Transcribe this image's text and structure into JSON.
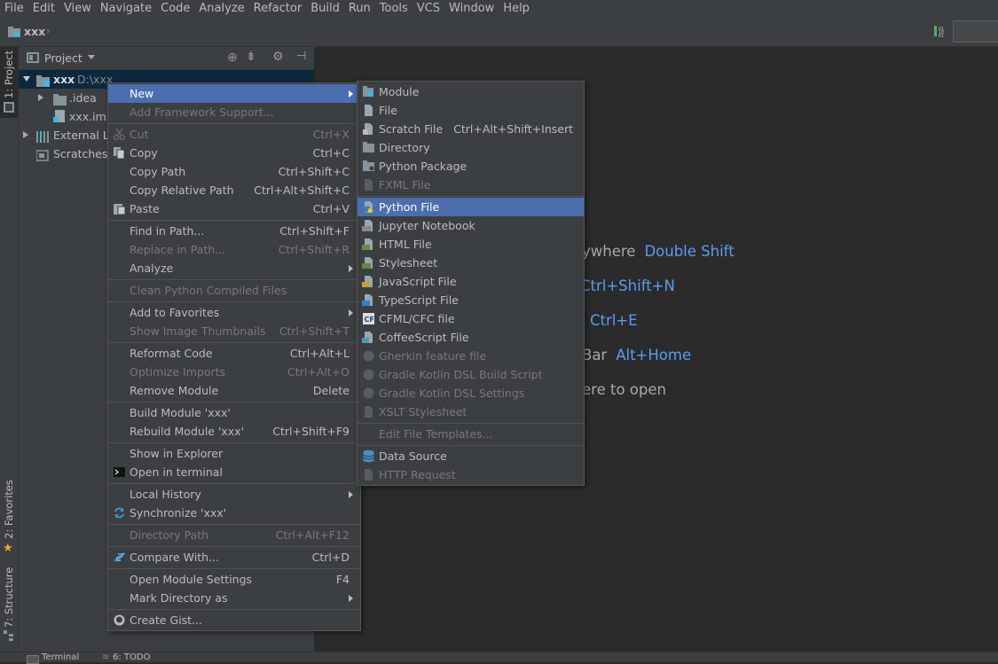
{
  "menubar": [
    "File",
    "Edit",
    "View",
    "Navigate",
    "Code",
    "Analyze",
    "Refactor",
    "Build",
    "Run",
    "Tools",
    "VCS",
    "Window",
    "Help"
  ],
  "breadcrumb": {
    "project": "xxx"
  },
  "side_tabs": {
    "project": "1: Project",
    "favorites": "2: Favorites",
    "structure": "7: Structure"
  },
  "project_panel": {
    "title": "Project"
  },
  "tree": [
    {
      "label": "xxx",
      "path": "D:\\xxx"
    },
    {
      "label": ".idea"
    },
    {
      "label": "xxx.iml"
    },
    {
      "label": "External Li"
    },
    {
      "label": "Scratches a"
    }
  ],
  "context_menu": [
    {
      "label": "New",
      "shortcut": "",
      "submenu": true,
      "highlight": true
    },
    {
      "label": "Add Framework Support...",
      "disabled": true
    },
    {
      "label": "Cut",
      "shortcut": "Ctrl+X",
      "disabled": true,
      "icon": "scissors-icon"
    },
    {
      "label": "Copy",
      "shortcut": "Ctrl+C",
      "icon": "copy-icon"
    },
    {
      "label": "Copy Path",
      "shortcut": "Ctrl+Shift+C"
    },
    {
      "label": "Copy Relative Path",
      "shortcut": "Ctrl+Alt+Shift+C"
    },
    {
      "label": "Paste",
      "shortcut": "Ctrl+V",
      "icon": "paste-icon"
    },
    {
      "label": "Find in Path...",
      "shortcut": "Ctrl+Shift+F"
    },
    {
      "label": "Replace in Path...",
      "shortcut": "Ctrl+Shift+R",
      "disabled": true
    },
    {
      "label": "Analyze",
      "submenu": true
    },
    {
      "label": "Clean Python Compiled Files",
      "disabled": true
    },
    {
      "label": "Add to Favorites",
      "submenu": true
    },
    {
      "label": "Show Image Thumbnails",
      "shortcut": "Ctrl+Shift+T",
      "disabled": true
    },
    {
      "label": "Reformat Code",
      "shortcut": "Ctrl+Alt+L"
    },
    {
      "label": "Optimize Imports",
      "shortcut": "Ctrl+Alt+O",
      "disabled": true
    },
    {
      "label": "Remove Module",
      "shortcut": "Delete"
    },
    {
      "label": "Build Module 'xxx'"
    },
    {
      "label": "Rebuild Module 'xxx'",
      "shortcut": "Ctrl+Shift+F9"
    },
    {
      "label": "Show in Explorer"
    },
    {
      "label": "Open in terminal",
      "icon": "terminal-icon"
    },
    {
      "label": "Local History",
      "submenu": true
    },
    {
      "label": "Synchronize 'xxx'",
      "icon": "sync-icon"
    },
    {
      "label": "Directory Path",
      "shortcut": "Ctrl+Alt+F12",
      "disabled": true
    },
    {
      "label": "Compare With...",
      "shortcut": "Ctrl+D",
      "icon": "compare-icon"
    },
    {
      "label": "Open Module Settings",
      "shortcut": "F4"
    },
    {
      "label": "Mark Directory as",
      "submenu": true
    },
    {
      "label": "Create Gist...",
      "icon": "github-icon"
    }
  ],
  "submenu_new": [
    {
      "label": "Module",
      "icon": "module-icon"
    },
    {
      "label": "File",
      "icon": "file-icon"
    },
    {
      "label": "Scratch File",
      "shortcut": "Ctrl+Alt+Shift+Insert",
      "icon": "scratch-file-icon"
    },
    {
      "label": "Directory",
      "icon": "folder-icon"
    },
    {
      "label": "Python Package",
      "icon": "package-icon"
    },
    {
      "label": "FXML File",
      "disabled": true,
      "icon": "fxml-icon"
    },
    {
      "label": "Python File",
      "highlight": true,
      "icon": "python-icon"
    },
    {
      "label": "Jupyter Notebook",
      "icon": "jupyter-icon"
    },
    {
      "label": "HTML File",
      "icon": "html-icon"
    },
    {
      "label": "Stylesheet",
      "icon": "css-icon"
    },
    {
      "label": "JavaScript File",
      "icon": "js-icon"
    },
    {
      "label": "TypeScript File",
      "icon": "ts-icon"
    },
    {
      "label": "CFML/CFC file",
      "icon": "cf-icon"
    },
    {
      "label": "CoffeeScript File",
      "icon": "coffee-icon"
    },
    {
      "label": "Gherkin feature file",
      "disabled": true,
      "icon": "gherkin-icon"
    },
    {
      "label": "Gradle Kotlin DSL Build Script",
      "disabled": true,
      "icon": "gradle-icon"
    },
    {
      "label": "Gradle Kotlin DSL Settings",
      "disabled": true,
      "icon": "gradle-icon"
    },
    {
      "label": "XSLT Stylesheet",
      "disabled": true,
      "icon": "xslt-icon"
    },
    {
      "label": "Edit File Templates...",
      "disabled": true
    },
    {
      "label": "Data Source",
      "icon": "database-icon"
    },
    {
      "label": "HTTP Request",
      "disabled": true,
      "icon": "http-icon"
    }
  ],
  "editor_hints": [
    {
      "text": "ywhere",
      "key": "Double Shift"
    },
    {
      "text": "",
      "key": "Ctrl+Shift+N"
    },
    {
      "text": "",
      "key": "Ctrl+E"
    },
    {
      "text": "Bar",
      "key": "Alt+Home"
    },
    {
      "text": "ere to open",
      "key": ""
    }
  ],
  "bottom_tabs": {
    "terminal": "Terminal",
    "todo": "6: TODO"
  },
  "colors": {
    "highlight": "#4b6eaf",
    "menu_bg": "#3c3f41",
    "editor_bg": "#2b2b2b",
    "link": "#589df6"
  }
}
